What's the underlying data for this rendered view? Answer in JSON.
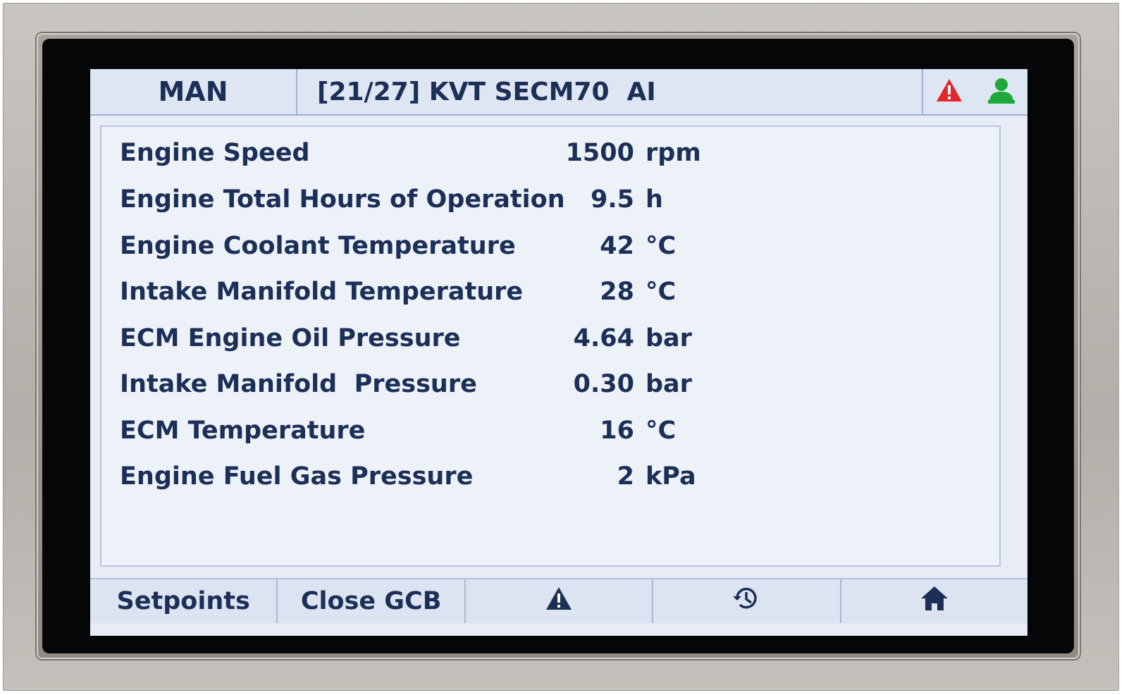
{
  "header": {
    "mode": "MAN",
    "title": "[21/27] KVT SECM70  AI",
    "alarm_icon": "warning-triangle-icon",
    "user_icon": "user-icon",
    "colors": {
      "alarm": "#e4262b",
      "user": "#1fa83a",
      "text": "#1b2f57"
    }
  },
  "measurements": [
    {
      "label": "Engine Speed",
      "value": "1500",
      "unit": "rpm"
    },
    {
      "label": "Engine Total Hours of Operation",
      "value": "9.5",
      "unit": "h"
    },
    {
      "label": "Engine Coolant Temperature",
      "value": "42",
      "unit": "°C"
    },
    {
      "label": "Intake Manifold Temperature",
      "value": "28",
      "unit": "°C"
    },
    {
      "label": "ECM Engine Oil Pressure",
      "value": "4.64",
      "unit": "bar"
    },
    {
      "label": "Intake Manifold  Pressure",
      "value": "0.30",
      "unit": "bar"
    },
    {
      "label": "ECM Temperature",
      "value": "16",
      "unit": "°C"
    },
    {
      "label": "Engine Fuel Gas Pressure",
      "value": "2",
      "unit": "kPa"
    }
  ],
  "footer": {
    "setpoints_label": "Setpoints",
    "close_gcb_label": "Close GCB",
    "alarms_icon": "warning-triangle-icon",
    "history_icon": "history-clock-icon",
    "home_icon": "home-icon"
  }
}
